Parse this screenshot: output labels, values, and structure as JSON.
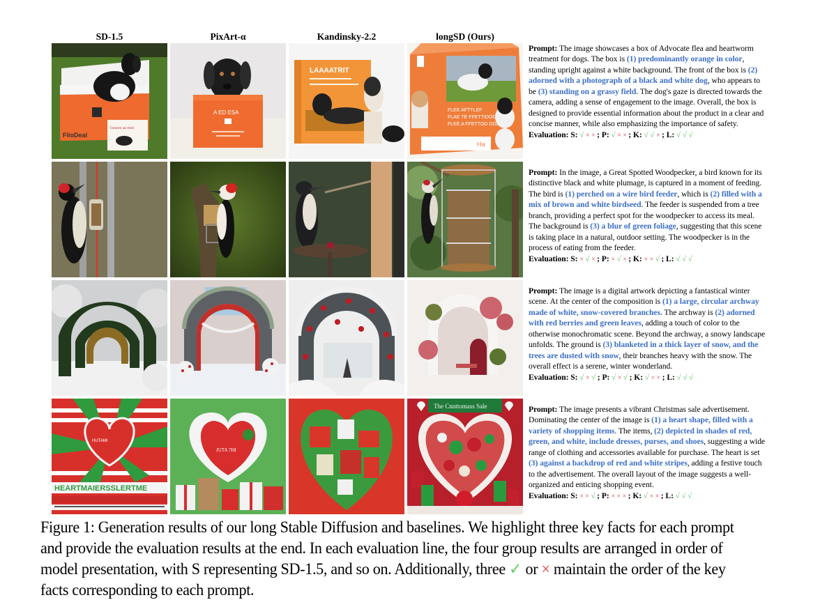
{
  "figure": {
    "column_headers": [
      "SD-1.5",
      "PixArt-α",
      "Kandinsky-2.2",
      "longSD (Ours)"
    ],
    "rows": [
      {
        "images": [
          {
            "model": "SD-1.5",
            "subject": "black and white dog sitting in open orange box on grass",
            "box_text": "FlioDeal",
            "small_box_text": "Geonro au resti"
          },
          {
            "model": "PixArt-α",
            "subject": "black dog peeking out of orange box against white background",
            "box_text": "A ED ESA"
          },
          {
            "model": "Kandinsky-2.2",
            "subject": "orange box with dog photo and a dog standing beside",
            "box_text": "LAAAATRIT"
          },
          {
            "model": "longSD (Ours)",
            "subject": "orange box with photo of black and white dog on grassy field",
            "box_text": "FLEE AFTTLEF FLAE TE FFETTIDOG FLEE A FFETTOD DGID",
            "tag": "Ha"
          }
        ],
        "prompt_label": "Prompt:",
        "prompt_parts": [
          {
            "t": "The image showcases a box of Advocate flea and heartworm treatment for dogs. The box is ",
            "h": false
          },
          {
            "t": "(1) predominantly orange in color",
            "h": true
          },
          {
            "t": ", standing upright against a white background. The front of the box is ",
            "h": false
          },
          {
            "t": "(2) adorned with a photograph of a black and white dog",
            "h": true
          },
          {
            "t": ", who appears to be ",
            "h": false
          },
          {
            "t": "(3) standing on a grassy field",
            "h": true
          },
          {
            "t": ". The dog's gaze is directed towards the camera, adding a sense of engagement to the image. Overall, the box is designed to provide essential information about the product in a clear and concise manner, while also emphasizing the importance of safety.",
            "h": false
          }
        ],
        "evaluation_label": "Evaluation:",
        "evaluation": [
          {
            "model": "S",
            "marks": [
              true,
              false,
              false
            ]
          },
          {
            "model": "P",
            "marks": [
              true,
              false,
              false
            ]
          },
          {
            "model": "K",
            "marks": [
              true,
              true,
              false
            ]
          },
          {
            "model": "L",
            "marks": [
              true,
              true,
              true
            ]
          }
        ]
      },
      {
        "images": [
          {
            "model": "SD-1.5",
            "subject": "woodpecker on metal pole with small tube feeder"
          },
          {
            "model": "PixArt-α",
            "subject": "woodpecker beside tree stump with seed feeder, green background"
          },
          {
            "model": "Kandinsky-2.2",
            "subject": "bird perched on wooden post near a platform feeder"
          },
          {
            "model": "longSD (Ours)",
            "subject": "great spotted woodpecker on wire cage feeder full of seeds, green foliage"
          }
        ],
        "prompt_label": "Prompt:",
        "prompt_parts": [
          {
            "t": "In the image, a Great Spotted Woodpecker, a bird known for its distinctive black and white plumage, is captured in a moment of feeding. The bird is ",
            "h": false
          },
          {
            "t": "(1) perched on a wire bird feeder",
            "h": true
          },
          {
            "t": ", which is ",
            "h": false
          },
          {
            "t": "(2) filled with a mix of brown and white birdseed",
            "h": true
          },
          {
            "t": ". The feeder is suspended from a tree branch, providing a perfect spot for the woodpecker to access its meal. The background is ",
            "h": false
          },
          {
            "t": "(3) a blur of green foliage",
            "h": true
          },
          {
            "t": ", suggesting that this scene is taking place in a natural, outdoor setting. The woodpecker is in the process of eating from the feeder.",
            "h": false
          }
        ],
        "evaluation_label": "Evaluation:",
        "evaluation": [
          {
            "model": "S",
            "marks": [
              false,
              true,
              false
            ]
          },
          {
            "model": "P",
            "marks": [
              false,
              true,
              false
            ]
          },
          {
            "model": "K",
            "marks": [
              false,
              false,
              true
            ]
          },
          {
            "model": "L",
            "marks": [
              true,
              true,
              true
            ]
          }
        ]
      },
      {
        "images": [
          {
            "model": "SD-1.5",
            "subject": "series of green hedge archways in snowy park"
          },
          {
            "model": "PixArt-α",
            "subject": "stone archway with red inner frame, garland, snowy field"
          },
          {
            "model": "Kandinsky-2.2",
            "subject": "dark stone archway covered in snow and red berries"
          },
          {
            "model": "longSD (Ours)",
            "subject": "white snow-covered archway with red berries and green leaves"
          }
        ],
        "prompt_label": "Prompt:",
        "prompt_parts": [
          {
            "t": "The image is a digital artwork depicting a fantastical winter scene. At the center of the composition is ",
            "h": false
          },
          {
            "t": "(1) a large, circular archway made of white, snow-covered branches.",
            "h": true
          },
          {
            "t": " The archway is ",
            "h": false
          },
          {
            "t": "(2) adorned with red berries and green leaves",
            "h": true
          },
          {
            "t": ", adding a touch of color to the otherwise monochromatic scene. Beyond the archway, a snowy landscape unfolds. The ground is ",
            "h": false
          },
          {
            "t": "(3) blanketed in a thick layer of snow, and the trees are dusted with snow",
            "h": true
          },
          {
            "t": ", their branches heavy with the snow. The overall effect is a serene, winter wonderland.",
            "h": false
          }
        ],
        "evaluation_label": "Evaluation:",
        "evaluation": [
          {
            "model": "S",
            "marks": [
              true,
              false,
              true
            ]
          },
          {
            "model": "P",
            "marks": [
              true,
              false,
              true
            ]
          },
          {
            "model": "K",
            "marks": [
              true,
              false,
              false
            ]
          },
          {
            "model": "L",
            "marks": [
              true,
              true,
              true
            ]
          }
        ]
      },
      {
        "images": [
          {
            "model": "SD-1.5",
            "subject": "red and green striped poster with heart",
            "banner_text": "HEARTMAIERSSLERTME"
          },
          {
            "model": "PixArt-α",
            "subject": "red heart on green striped burst with gift boxes",
            "heart_text": "JUTA 7HI"
          },
          {
            "model": "Kandinsky-2.2",
            "subject": "heart collage of red and green items on red background"
          },
          {
            "model": "longSD (Ours)",
            "subject": "heart shelf filled with dresses, purses, shoes, ornaments",
            "banner_text": "The Cnnttomass Sale"
          }
        ],
        "prompt_label": "Prompt:",
        "prompt_parts": [
          {
            "t": "The image presents a vibrant Christmas sale advertisement. Dominating the center of the image is ",
            "h": false
          },
          {
            "t": "(1) a heart shape, filled with a variety of shopping items",
            "h": true
          },
          {
            "t": ". The items, ",
            "h": false
          },
          {
            "t": "(2) depicted in shades of red, green, and white, include dresses, purses, and shoes",
            "h": true
          },
          {
            "t": ", suggesting a wide range of clothing and accessories available for purchase. The heart is set ",
            "h": false
          },
          {
            "t": "(3) against a backdrop of red and white stripes",
            "h": true
          },
          {
            "t": ", adding a festive touch to the advertisement. The overall layout of the image suggests a well-organized and enticing shopping event.",
            "h": false
          }
        ],
        "evaluation_label": "Evaluation:",
        "evaluation": [
          {
            "model": "S",
            "marks": [
              false,
              false,
              true
            ]
          },
          {
            "model": "P",
            "marks": [
              false,
              false,
              false
            ]
          },
          {
            "model": "K",
            "marks": [
              true,
              false,
              false
            ]
          },
          {
            "model": "L",
            "marks": [
              true,
              true,
              true
            ]
          }
        ]
      }
    ],
    "marks": {
      "check": "√",
      "cross": "×"
    },
    "caption": {
      "label": "Figure 1:",
      "before_check": " Generation results of our long Stable Diffusion and baselines.  We highlight three key facts for each prompt and provide the evaluation results at the end. In each evaluation line, the four group results are arranged in order of model presentation, with S representing SD-1.5, and so on. Additionally, three ",
      "check_glyph": "✓",
      "middle": " or ",
      "cross_glyph": "×",
      "after": " maintain the order of the key facts corresponding to each prompt."
    },
    "colors": {
      "highlight": "#3d6fc6",
      "check": "#66c26b",
      "cross": "#e0474c"
    }
  }
}
